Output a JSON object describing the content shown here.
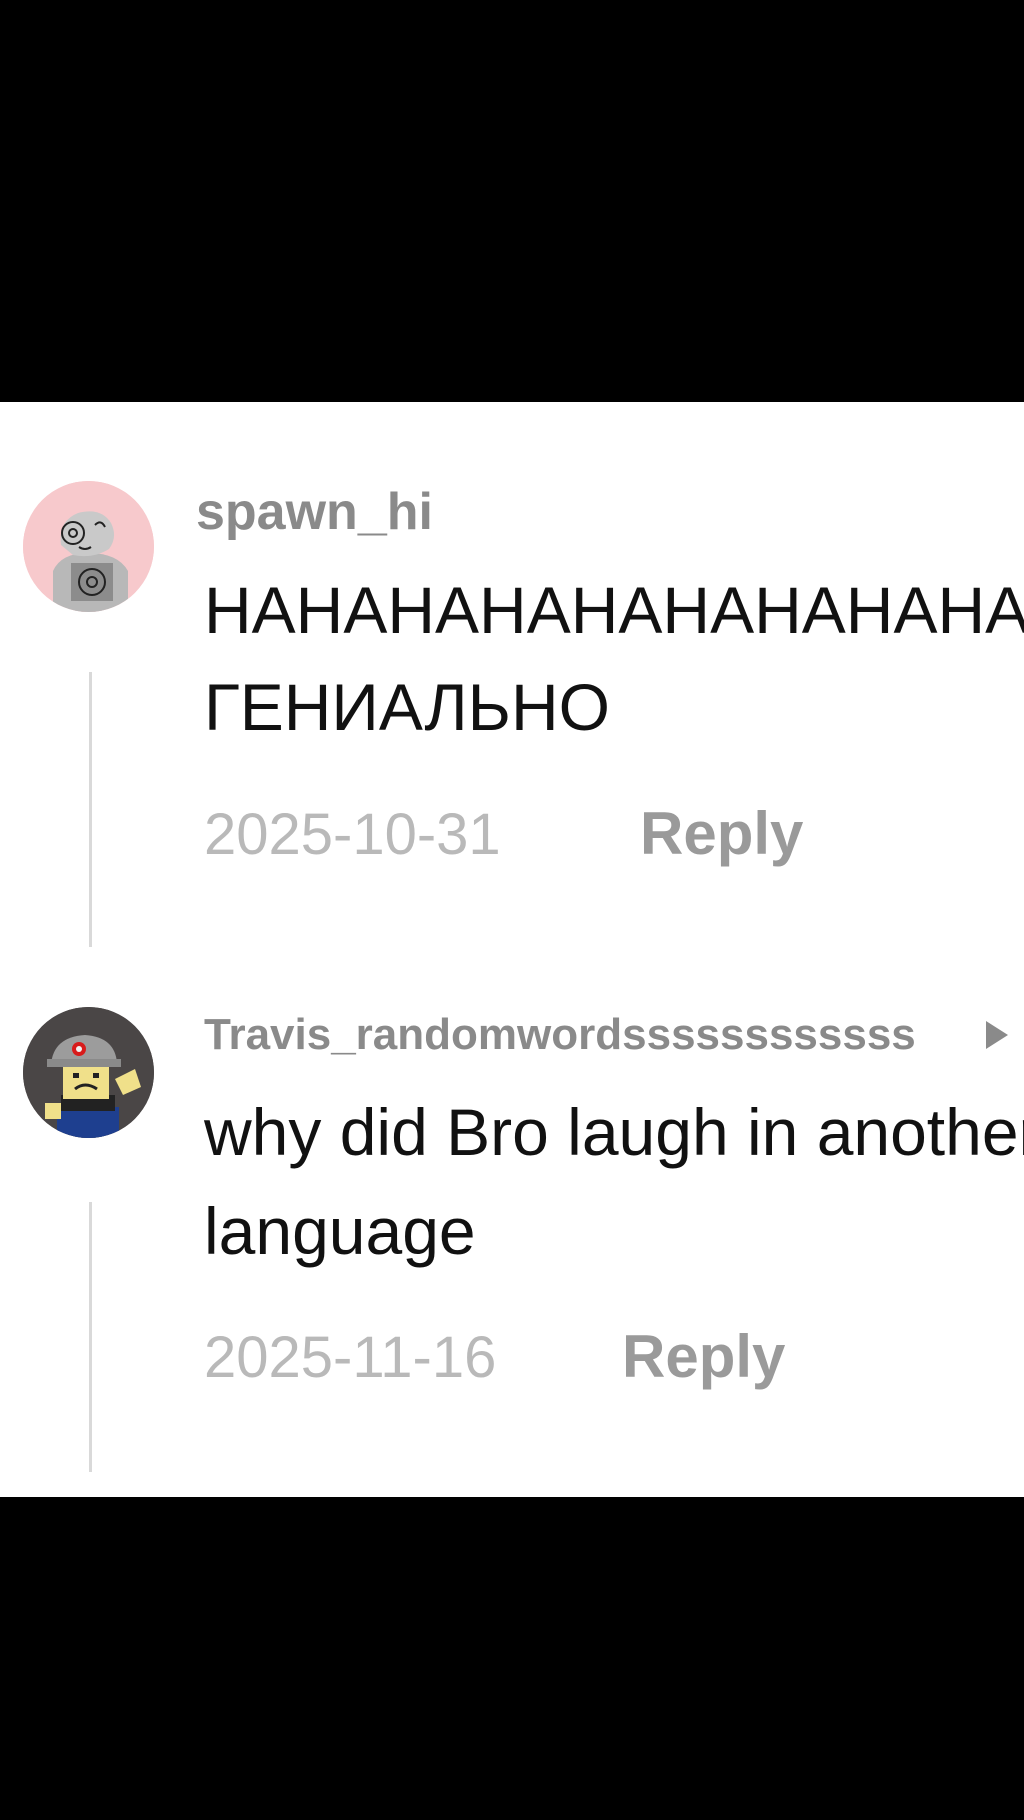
{
  "comments": [
    {
      "username": "spawn_hi",
      "text_line1": "НАНАНАНАНАНАНАНАНАНАНАНАН",
      "text_line2": "ГЕНИАЛЬНО",
      "date": "2025-10-31",
      "reply_label": "Reply",
      "avatar_bg": "#f7c9cc"
    },
    {
      "username": "Travis_randomwordssssssssssss",
      "text_line1": "why did Bro laugh in another",
      "text_line2": "language",
      "date": "2025-11-16",
      "reply_label": "Reply",
      "avatar_bg": "#4a4646"
    }
  ],
  "icons": {
    "username_arrow": "play-icon"
  },
  "colors": {
    "background_bars": "#000000",
    "panel": "#ffffff",
    "username": "#8a8a8a",
    "body_text": "#111111",
    "date": "#b9b9b9",
    "reply": "#9a9a9a"
  }
}
